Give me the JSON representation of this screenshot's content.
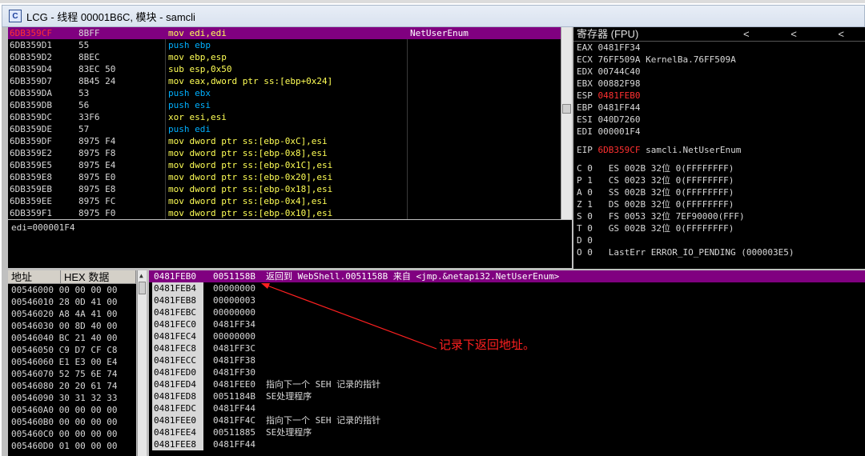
{
  "window": {
    "title": "LCG - 线程 00001B6C, 模块 - samcli",
    "icon": "C"
  },
  "disasm": {
    "rows": [
      {
        "addr": "6DB359CF",
        "hex": "8BFF",
        "ins": "mov edi,edi",
        "cmt": "NetUserEnum",
        "sel": true,
        "cls": "i-mov"
      },
      {
        "addr": "6DB359D1",
        "hex": "55",
        "ins": "push ebp",
        "cmt": "",
        "cls": "i-push"
      },
      {
        "addr": "6DB359D2",
        "hex": "8BEC",
        "ins": "mov ebp,esp",
        "cmt": "",
        "cls": "i-mov"
      },
      {
        "addr": "6DB359D4",
        "hex": "83EC 50",
        "ins": "sub esp,0x50",
        "cmt": "",
        "cls": "i-sub"
      },
      {
        "addr": "6DB359D7",
        "hex": "8B45 24",
        "ins": "mov eax,dword ptr ss:[ebp+0x24]",
        "cmt": "",
        "cls": "i-mov"
      },
      {
        "addr": "6DB359DA",
        "hex": "53",
        "ins": "push ebx",
        "cmt": "",
        "cls": "i-push"
      },
      {
        "addr": "6DB359DB",
        "hex": "56",
        "ins": "push esi",
        "cmt": "",
        "cls": "i-push"
      },
      {
        "addr": "6DB359DC",
        "hex": "33F6",
        "ins": "xor esi,esi",
        "cmt": "",
        "cls": "i-xor"
      },
      {
        "addr": "6DB359DE",
        "hex": "57",
        "ins": "push edi",
        "cmt": "",
        "cls": "i-push"
      },
      {
        "addr": "6DB359DF",
        "hex": "8975 F4",
        "ins": "mov dword ptr ss:[ebp-0xC],esi",
        "cmt": "",
        "cls": "i-mov"
      },
      {
        "addr": "6DB359E2",
        "hex": "8975 F8",
        "ins": "mov dword ptr ss:[ebp-0x8],esi",
        "cmt": "",
        "cls": "i-mov"
      },
      {
        "addr": "6DB359E5",
        "hex": "8975 E4",
        "ins": "mov dword ptr ss:[ebp-0x1C],esi",
        "cmt": "",
        "cls": "i-mov"
      },
      {
        "addr": "6DB359E8",
        "hex": "8975 E0",
        "ins": "mov dword ptr ss:[ebp-0x20],esi",
        "cmt": "",
        "cls": "i-mov"
      },
      {
        "addr": "6DB359EB",
        "hex": "8975 E8",
        "ins": "mov dword ptr ss:[ebp-0x18],esi",
        "cmt": "",
        "cls": "i-mov"
      },
      {
        "addr": "6DB359EE",
        "hex": "8975 FC",
        "ins": "mov dword ptr ss:[ebp-0x4],esi",
        "cmt": "",
        "cls": "i-mov"
      },
      {
        "addr": "6DB359F1",
        "hex": "8975 F0",
        "ins": "mov dword ptr ss:[ebp-0x10],esi",
        "cmt": "",
        "cls": "i-mov"
      }
    ]
  },
  "info": {
    "text": "edi=000001F4"
  },
  "registers": {
    "header": "寄存器 (FPU)",
    "nav": "< < <",
    "gp": [
      {
        "name": "EAX",
        "val": "0481FF34",
        "extra": "",
        "red": false
      },
      {
        "name": "ECX",
        "val": "76FF509A",
        "extra": "KernelBa.76FF509A",
        "red": false
      },
      {
        "name": "EDX",
        "val": "00744C40",
        "extra": "",
        "red": false
      },
      {
        "name": "EBX",
        "val": "00882F98",
        "extra": "",
        "red": false
      },
      {
        "name": "ESP",
        "val": "0481FEB0",
        "extra": "",
        "red": true
      },
      {
        "name": "EBP",
        "val": "0481FF44",
        "extra": "",
        "red": false
      },
      {
        "name": "ESI",
        "val": "040D7260",
        "extra": "",
        "red": false
      },
      {
        "name": "EDI",
        "val": "000001F4",
        "extra": "",
        "red": false
      }
    ],
    "eip": {
      "name": "EIP",
      "val": "6DB359CF",
      "extra": "samcli.NetUserEnum"
    },
    "flags": [
      "C 0   ES 002B 32位 0(FFFFFFFF)",
      "P 1   CS 0023 32位 0(FFFFFFFF)",
      "A 0   SS 002B 32位 0(FFFFFFFF)",
      "Z 1   DS 002B 32位 0(FFFFFFFF)",
      "S 0   FS 0053 32位 7EF90000(FFF)",
      "T 0   GS 002B 32位 0(FFFFFFFF)",
      "D 0",
      "O 0   LastErr ERROR_IO_PENDING (000003E5)"
    ]
  },
  "dump": {
    "head_addr": "地址",
    "head_hex": "HEX 数据",
    "rows": [
      "00546000 00 00 00 00",
      "00546010 28 0D 41 00",
      "00546020 A8 4A 41 00",
      "00546030 00 8D 40 00",
      "00546040 BC 21 40 00",
      "00546050 C9 D7 CF C8",
      "00546060 E1 E3 00 E4",
      "00546070 52 75 6E 74",
      "00546080 20 20 61 74",
      "00546090 30 31 32 33",
      "005460A0 00 00 00 00",
      "005460B0 00 00 00 00",
      "005460C0 00 00 00 00",
      "005460D0 01 00 00 00"
    ]
  },
  "stack": {
    "rows": [
      {
        "a": "0481FEB0",
        "v": "0051158B",
        "c": "返回到 WebShell.0051158B 来自 <jmp.&netapi32.NetUserEnum>",
        "sel": true
      },
      {
        "a": "0481FEB4",
        "v": "00000000",
        "c": ""
      },
      {
        "a": "0481FEB8",
        "v": "00000003",
        "c": ""
      },
      {
        "a": "0481FEBC",
        "v": "00000000",
        "c": ""
      },
      {
        "a": "0481FEC0",
        "v": "0481FF34",
        "c": ""
      },
      {
        "a": "0481FEC4",
        "v": "00000000",
        "c": ""
      },
      {
        "a": "0481FEC8",
        "v": "0481FF3C",
        "c": ""
      },
      {
        "a": "0481FECC",
        "v": "0481FF38",
        "c": ""
      },
      {
        "a": "0481FED0",
        "v": "0481FF30",
        "c": ""
      },
      {
        "a": "0481FED4",
        "v": "0481FEE0",
        "c": "指向下一个 SEH 记录的指针"
      },
      {
        "a": "0481FED8",
        "v": "0051184B",
        "c": "SE处理程序"
      },
      {
        "a": "0481FEDC",
        "v": "0481FF44",
        "c": ""
      },
      {
        "a": "0481FEE0",
        "v": "0481FF4C",
        "c": "指向下一个 SEH 记录的指针"
      },
      {
        "a": "0481FEE4",
        "v": "00511885",
        "c": "SE处理程序"
      },
      {
        "a": "0481FEE8",
        "v": "0481FF44",
        "c": ""
      }
    ]
  },
  "annotation": {
    "text": "记录下返回地址。",
    "color": "#ff2020"
  }
}
